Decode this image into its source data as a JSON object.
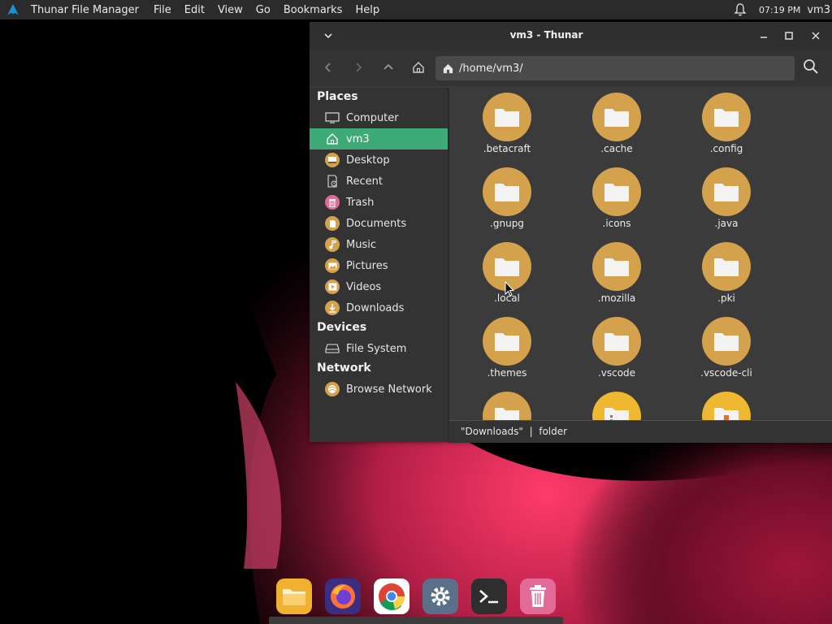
{
  "top_panel": {
    "app_name": "Thunar File Manager",
    "menu": [
      "File",
      "Edit",
      "View",
      "Go",
      "Bookmarks",
      "Help"
    ],
    "clock": "07:19 PM",
    "user": "vm3",
    "icons": {
      "logo": "arch-logo-icon",
      "notifications": "bell-icon"
    }
  },
  "window": {
    "title": "vm3 - Thunar",
    "location": "/home/vm3/",
    "sidebar": {
      "sections": [
        {
          "label": "Places",
          "items": [
            {
              "label": "Computer",
              "icon": "computer-icon"
            },
            {
              "label": "vm3",
              "icon": "home-icon",
              "active": true
            },
            {
              "label": "Desktop",
              "icon": "desktop-icon"
            },
            {
              "label": "Recent",
              "icon": "recent-icon"
            },
            {
              "label": "Trash",
              "icon": "trash-icon"
            },
            {
              "label": "Documents",
              "icon": "documents-icon"
            },
            {
              "label": "Music",
              "icon": "music-icon"
            },
            {
              "label": "Pictures",
              "icon": "pictures-icon"
            },
            {
              "label": "Videos",
              "icon": "videos-icon"
            },
            {
              "label": "Downloads",
              "icon": "downloads-icon"
            }
          ]
        },
        {
          "label": "Devices",
          "items": [
            {
              "label": "File System",
              "icon": "drive-icon"
            }
          ]
        },
        {
          "label": "Network",
          "items": [
            {
              "label": "Browse Network",
              "icon": "network-icon"
            }
          ]
        }
      ]
    },
    "files": [
      ".betacraft",
      ".cache",
      ".config",
      ".gnupg",
      ".icons",
      ".java",
      ".local",
      ".mozilla",
      ".pki",
      ".themes",
      ".vscode",
      ".vscode-cli",
      "",
      "",
      ""
    ],
    "status": "\"Downloads\"  |  folder"
  },
  "dock": {
    "items": [
      "files-icon",
      "firefox-icon",
      "chrome-icon",
      "settings-icon",
      "terminal-icon",
      "trash-icon"
    ]
  },
  "colors": {
    "accent": "#3daa78",
    "folder": "#d4a24c",
    "panel": "#2b2b2b"
  }
}
